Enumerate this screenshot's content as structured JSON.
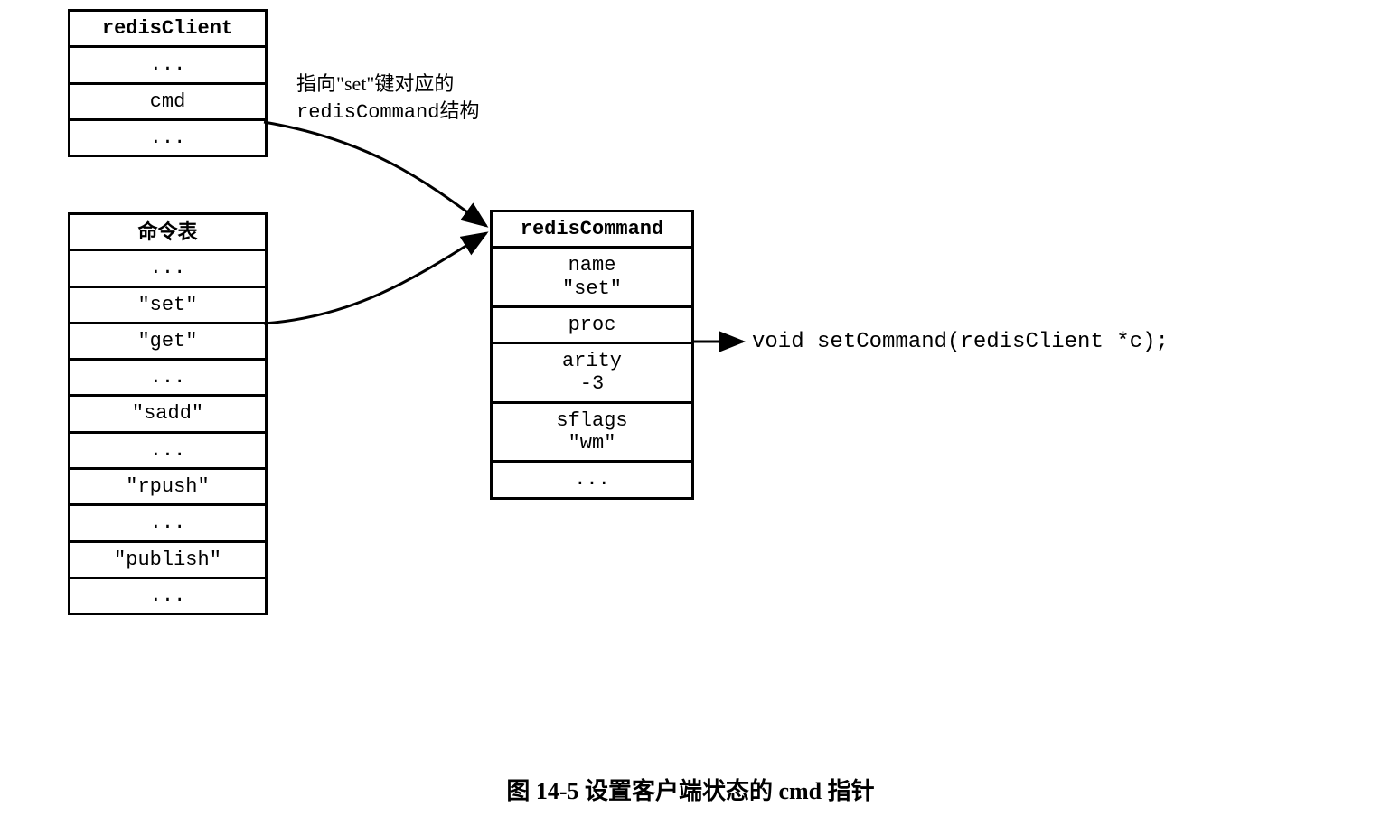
{
  "redisClient": {
    "title": "redisClient",
    "rows": [
      "...",
      "cmd",
      "..."
    ]
  },
  "commandTable": {
    "title": "命令表",
    "rows": [
      "...",
      "\"set\"",
      "\"get\"",
      "...",
      "\"sadd\"",
      "...",
      "\"rpush\"",
      "...",
      "\"publish\"",
      "..."
    ]
  },
  "redisCommand": {
    "title": "redisCommand",
    "rows": [
      "name\n\"set\"",
      "proc",
      "arity\n-3",
      "sflags\n\"wm\"",
      "..."
    ]
  },
  "annotation": {
    "line1": "指向\"set\"键对应的",
    "line2_prefix": "redisCommand",
    "line2_suffix": "结构"
  },
  "functionSignature": "void setCommand(redisClient *c);",
  "caption": "图 14-5  设置客户端状态的 cmd 指针"
}
